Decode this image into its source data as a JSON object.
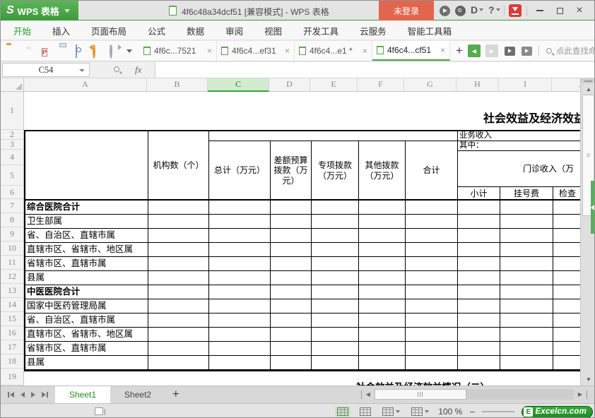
{
  "window": {
    "app_button_label": "WPS 表格",
    "doc_title": "4f6c48a34dcf51 [兼容模式] - WPS 表格",
    "login_label": "未登录"
  },
  "menu_tabs": [
    "开始",
    "插入",
    "页面布局",
    "公式",
    "数据",
    "审阅",
    "视图",
    "开发工具",
    "云服务",
    "智能工具箱"
  ],
  "menu_active": "开始",
  "toolbar": {
    "doc_tabs": [
      {
        "label": "4f6c...7521",
        "active": false
      },
      {
        "label": "4f6c4...ef31",
        "active": false
      },
      {
        "label": "4f6c4...e1 *",
        "active": false
      },
      {
        "label": "4f6c4...cf51",
        "active": true
      }
    ],
    "find_label": "点此查找命令"
  },
  "formula_bar": {
    "cell_ref": "C54",
    "fx_label": "fx"
  },
  "grid": {
    "column_headers": [
      "A",
      "B",
      "C",
      "D",
      "E",
      "F",
      "G",
      "H",
      "I",
      "J"
    ],
    "selected_column": "C",
    "row_numbers": [
      "1",
      "2",
      "3",
      "4",
      "5",
      "6",
      "7",
      "8",
      "9",
      "10",
      "11",
      "12",
      "13",
      "14",
      "15",
      "16",
      "17",
      "18",
      "19"
    ],
    "sheet_title_partial": "社会效益及经济效益情",
    "next_section_title": "社会效益及经济效益情况（二）",
    "table": {
      "headers": {
        "org_count": "机构数（个）",
        "total": "总计（万元）",
        "diff_budget": "差额预算拨款（万元）",
        "special": "专项拨款（万元）",
        "other": "其他拨款（万元）",
        "sum": "合计",
        "business_income": "业务收入",
        "among": "其中：",
        "outpatient_income": "门诊收入（万",
        "subtotal": "小计",
        "registration_fee": "挂号费",
        "exam_fee": "检查"
      },
      "row_labels": [
        {
          "label": "综合医院合计",
          "bold": true
        },
        {
          "label": "卫生部属",
          "bold": false
        },
        {
          "label": "省、自治区、直辖市属",
          "bold": false
        },
        {
          "label": "直辖市区、省辖市、地区属",
          "bold": false
        },
        {
          "label": "省辖市区、直辖市属",
          "bold": false
        },
        {
          "label": "县属",
          "bold": false
        },
        {
          "label": "中医医院合计",
          "bold": true
        },
        {
          "label": "国家中医药管理局属",
          "bold": false
        },
        {
          "label": "省、自治区、直辖市属",
          "bold": false
        },
        {
          "label": "直辖市区、省辖市、地区属",
          "bold": false
        },
        {
          "label": "省辖市区、直辖市属",
          "bold": false
        },
        {
          "label": "县属",
          "bold": false
        }
      ]
    }
  },
  "sheet_tabs": [
    {
      "label": "Sheet1",
      "active": true
    },
    {
      "label": "Sheet2",
      "active": false
    }
  ],
  "status_bar": {
    "zoom_level": "100 %",
    "brand_initial": "E",
    "brand": "Excelcn.com"
  },
  "colors": {
    "accent_green": "#47a838",
    "login_red": "#e2664d",
    "selection_green": "#2fa53c",
    "brand_green": "#2b9630"
  }
}
